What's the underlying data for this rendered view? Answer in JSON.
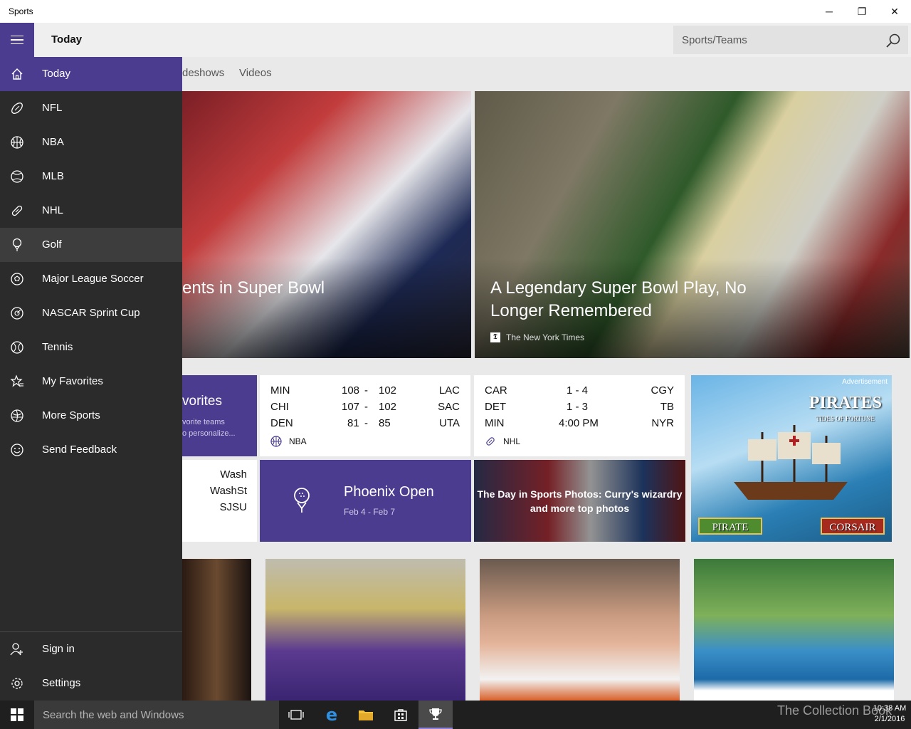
{
  "window": {
    "title": "Sports",
    "controls": {
      "minimize": "─",
      "restore": "❐",
      "close": "✕"
    }
  },
  "header": {
    "page_title": "Today",
    "search_placeholder": "Sports/Teams"
  },
  "tabs": [
    "deshows",
    "Videos"
  ],
  "sidebar": {
    "items": [
      {
        "label": "Today",
        "icon": "home-icon"
      },
      {
        "label": "NFL",
        "icon": "football-icon"
      },
      {
        "label": "NBA",
        "icon": "basketball-icon"
      },
      {
        "label": "MLB",
        "icon": "baseball-icon"
      },
      {
        "label": "NHL",
        "icon": "hockey-icon"
      },
      {
        "label": "Golf",
        "icon": "golf-icon"
      },
      {
        "label": "Major League Soccer",
        "icon": "soccer-icon"
      },
      {
        "label": "NASCAR Sprint Cup",
        "icon": "racing-icon"
      },
      {
        "label": "Tennis",
        "icon": "tennis-icon"
      },
      {
        "label": "My Favorites",
        "icon": "star-list-icon"
      },
      {
        "label": "More Sports",
        "icon": "more-sports-icon"
      },
      {
        "label": "Send Feedback",
        "icon": "smiley-icon"
      }
    ],
    "bottom": [
      {
        "label": "Sign in",
        "icon": "add-user-icon"
      },
      {
        "label": "Settings",
        "icon": "gear-icon"
      }
    ]
  },
  "hero": {
    "left_title": "ents in Super Bowl",
    "right_title": "A Legendary Super Bowl Play, No Longer Remembered",
    "right_source": "The New York Times",
    "right_source_icon": "𝕿"
  },
  "favorites_tile": {
    "title": "vorites",
    "sub1": "vorite teams",
    "sub2": "o personalize..."
  },
  "nba_scores": {
    "rows": [
      {
        "home": "MIN",
        "score1": "108",
        "sep": "-",
        "score2": "102",
        "away": "LAC"
      },
      {
        "home": "CHI",
        "score1": "107",
        "sep": "-",
        "score2": "102",
        "away": "SAC"
      },
      {
        "home": "DEN",
        "score1": "81",
        "sep": "-",
        "score2": "85",
        "away": "UTA"
      }
    ],
    "league": "NBA"
  },
  "nhl_scores": {
    "rows": [
      {
        "home": "CAR",
        "score": "1  -  4",
        "away": "CGY"
      },
      {
        "home": "DET",
        "score": "1  -  3",
        "away": "TB"
      },
      {
        "home": "MIN",
        "score": "4:00 PM",
        "away": "NYR"
      }
    ],
    "league": "NHL"
  },
  "college_tile": {
    "teams": [
      "Wash",
      "WashSt",
      "SJSU"
    ]
  },
  "phoenix_tile": {
    "title": "Phoenix Open",
    "dates": "Feb 4 - Feb 7"
  },
  "photo_tile": {
    "title": "The Day in Sports Photos: Curry's wizardry and more top photos"
  },
  "ad_tile": {
    "label": "Advertisement",
    "brand": "PIRATES",
    "tagline": "TIDES OF FORTUNE",
    "left_button": "PIRATE",
    "right_button": "CORSAIR"
  },
  "taskbar": {
    "search_placeholder": "Search the web and Windows",
    "time": "10:38 AM",
    "date": "2/1/2016",
    "watermark": "The Collection Book"
  },
  "colors": {
    "accent": "#4b3c8f",
    "sidebar": "#2b2b2b"
  }
}
